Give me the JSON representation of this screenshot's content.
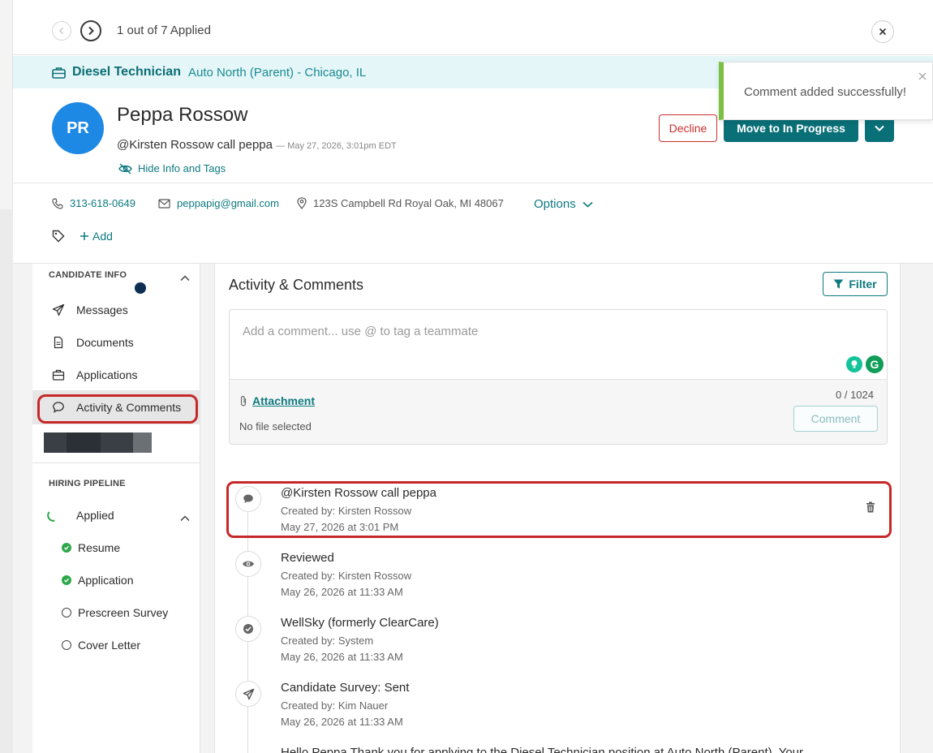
{
  "nav": {
    "counter": "1 out of 7 Applied"
  },
  "job": {
    "title": "Diesel Technician",
    "location": "Auto North (Parent) - Chicago, IL"
  },
  "candidate": {
    "initials": "PR",
    "name": "Peppa Rossow",
    "latest_comment": "@Kirsten Rossow call peppa",
    "latest_comment_time": "— May 27, 2026, 3:01pm EDT",
    "hide_info_label": "Hide Info and Tags",
    "phone": "313-618-0649",
    "email": "peppapig@gmail.com",
    "address": "123S Campbell Rd Royal Oak, MI 48067",
    "options_label": "Options",
    "add_tag_label": "Add"
  },
  "actions": {
    "decline": "Decline",
    "move": "Move to In Progress"
  },
  "toast": {
    "message": "Comment added successfully!",
    "accent": "#7bc043"
  },
  "sidebar": {
    "candidate_info_heading": "CANDIDATE INFO",
    "items": [
      {
        "label": "Messages",
        "icon": "send-icon"
      },
      {
        "label": "Documents",
        "icon": "document-icon"
      },
      {
        "label": "Applications",
        "icon": "briefcase-icon"
      },
      {
        "label": "Activity & Comments",
        "icon": "comment-icon",
        "active": true
      }
    ],
    "pipeline_heading": "HIRING PIPELINE",
    "stage": "Applied",
    "steps": [
      {
        "label": "Resume",
        "done": true
      },
      {
        "label": "Application",
        "done": true
      },
      {
        "label": "Prescreen Survey",
        "done": false
      },
      {
        "label": "Cover Letter",
        "done": false
      }
    ]
  },
  "main": {
    "title": "Activity & Comments",
    "filter_label": "Filter",
    "comment_placeholder": "Add a comment... use @ to tag a teammate",
    "attachment_label": "Attachment",
    "no_file": "No file selected",
    "char_count": "0 / 1024",
    "comment_button": "Comment",
    "timeline": [
      {
        "title": "@Kirsten Rossow call peppa",
        "created_by": "Created by: Kirsten Rossow",
        "date": "May 27, 2026 at 3:01 PM",
        "icon": "comment-icon",
        "highlighted": true
      },
      {
        "title": "Reviewed",
        "created_by": "Created by: Kirsten Rossow",
        "date": "May 26, 2026 at 11:33 AM",
        "icon": "eye-icon"
      },
      {
        "title": "WellSky (formerly ClearCare)",
        "created_by": "Created by: System",
        "date": "May 26, 2026 at 11:33 AM",
        "icon": "check-circle-icon"
      },
      {
        "title": "Candidate Survey: Sent",
        "created_by": "Created by: Kim Nauer",
        "date": "May 26, 2026 at 11:33 AM",
        "icon": "send-icon"
      }
    ],
    "truncated_entry": "Hello Peppa Thank you for applying to the Diesel Technician position at Auto North (Parent). Your"
  },
  "colors": {
    "primary": "#0a7078",
    "decline": "#c9302c",
    "avatar": "#1e88e5",
    "highlight": "#c62828"
  }
}
